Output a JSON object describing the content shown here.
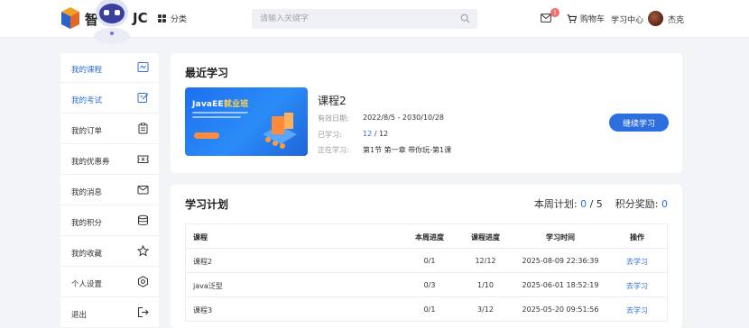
{
  "header": {
    "logo_left": "智",
    "logo_right": "JC",
    "category_label": "分类",
    "search_placeholder": "请输入关键字",
    "notification_count": "1",
    "cart_label": "购物车",
    "study_center_label": "学习中心",
    "username": "杰克"
  },
  "sidebar": {
    "items": [
      {
        "label": "我的课程",
        "icon": "course-icon",
        "active": true
      },
      {
        "label": "我的考试",
        "icon": "exam-edit-icon",
        "active": false
      },
      {
        "label": "我的订单",
        "icon": "order-clipboard-icon",
        "active": false
      },
      {
        "label": "我的优惠券",
        "icon": "coupon-icon",
        "active": false
      },
      {
        "label": "我的消息",
        "icon": "message-mail-icon",
        "active": false
      },
      {
        "label": "我的积分",
        "icon": "points-coins-icon",
        "active": false
      },
      {
        "label": "我的收藏",
        "icon": "star-icon",
        "active": false
      },
      {
        "label": "个人设置",
        "icon": "settings-gear-icon",
        "active": false
      },
      {
        "label": "退出",
        "icon": "logout-icon",
        "active": false
      }
    ]
  },
  "recent": {
    "title": "最近学习",
    "banner_title_a": "JavaEE",
    "banner_title_b": "就业班",
    "course_name": "课程2",
    "validity_label": "有效日期:",
    "validity_value": "2022/8/5 - 2030/10/28",
    "learned_label": "已学习:",
    "learned_done": "12",
    "learned_total": " / 12",
    "current_label": "正在学习:",
    "current_value": "第1节 第一章 带你玩-第1课",
    "continue_label": "继续学习"
  },
  "plan": {
    "title": "学习计划",
    "weekly_label": "本周计划: ",
    "weekly_done": "0",
    "weekly_sep": " / ",
    "weekly_total": "5",
    "points_label": "积分奖励: ",
    "points_value": "0",
    "columns": [
      "课程",
      "本周进度",
      "课程进度",
      "学习时间",
      "操作"
    ],
    "rows": [
      {
        "name": "课程2",
        "week": "0/1",
        "progress": "12/12",
        "time": "2025-08-09 22:36:39",
        "op": "去学习"
      },
      {
        "name": "java泛型",
        "week": "0/3",
        "progress": "1/10",
        "time": "2025-06-01 18:52:19",
        "op": "去学习"
      },
      {
        "name": "课程3",
        "week": "0/1",
        "progress": "3/12",
        "time": "2025-05-20 09:51:56",
        "op": "去学习"
      }
    ]
  },
  "colors": {
    "accent": "#2f6fdc",
    "button": "#2e6fe0",
    "badge": "#f56c6c"
  }
}
